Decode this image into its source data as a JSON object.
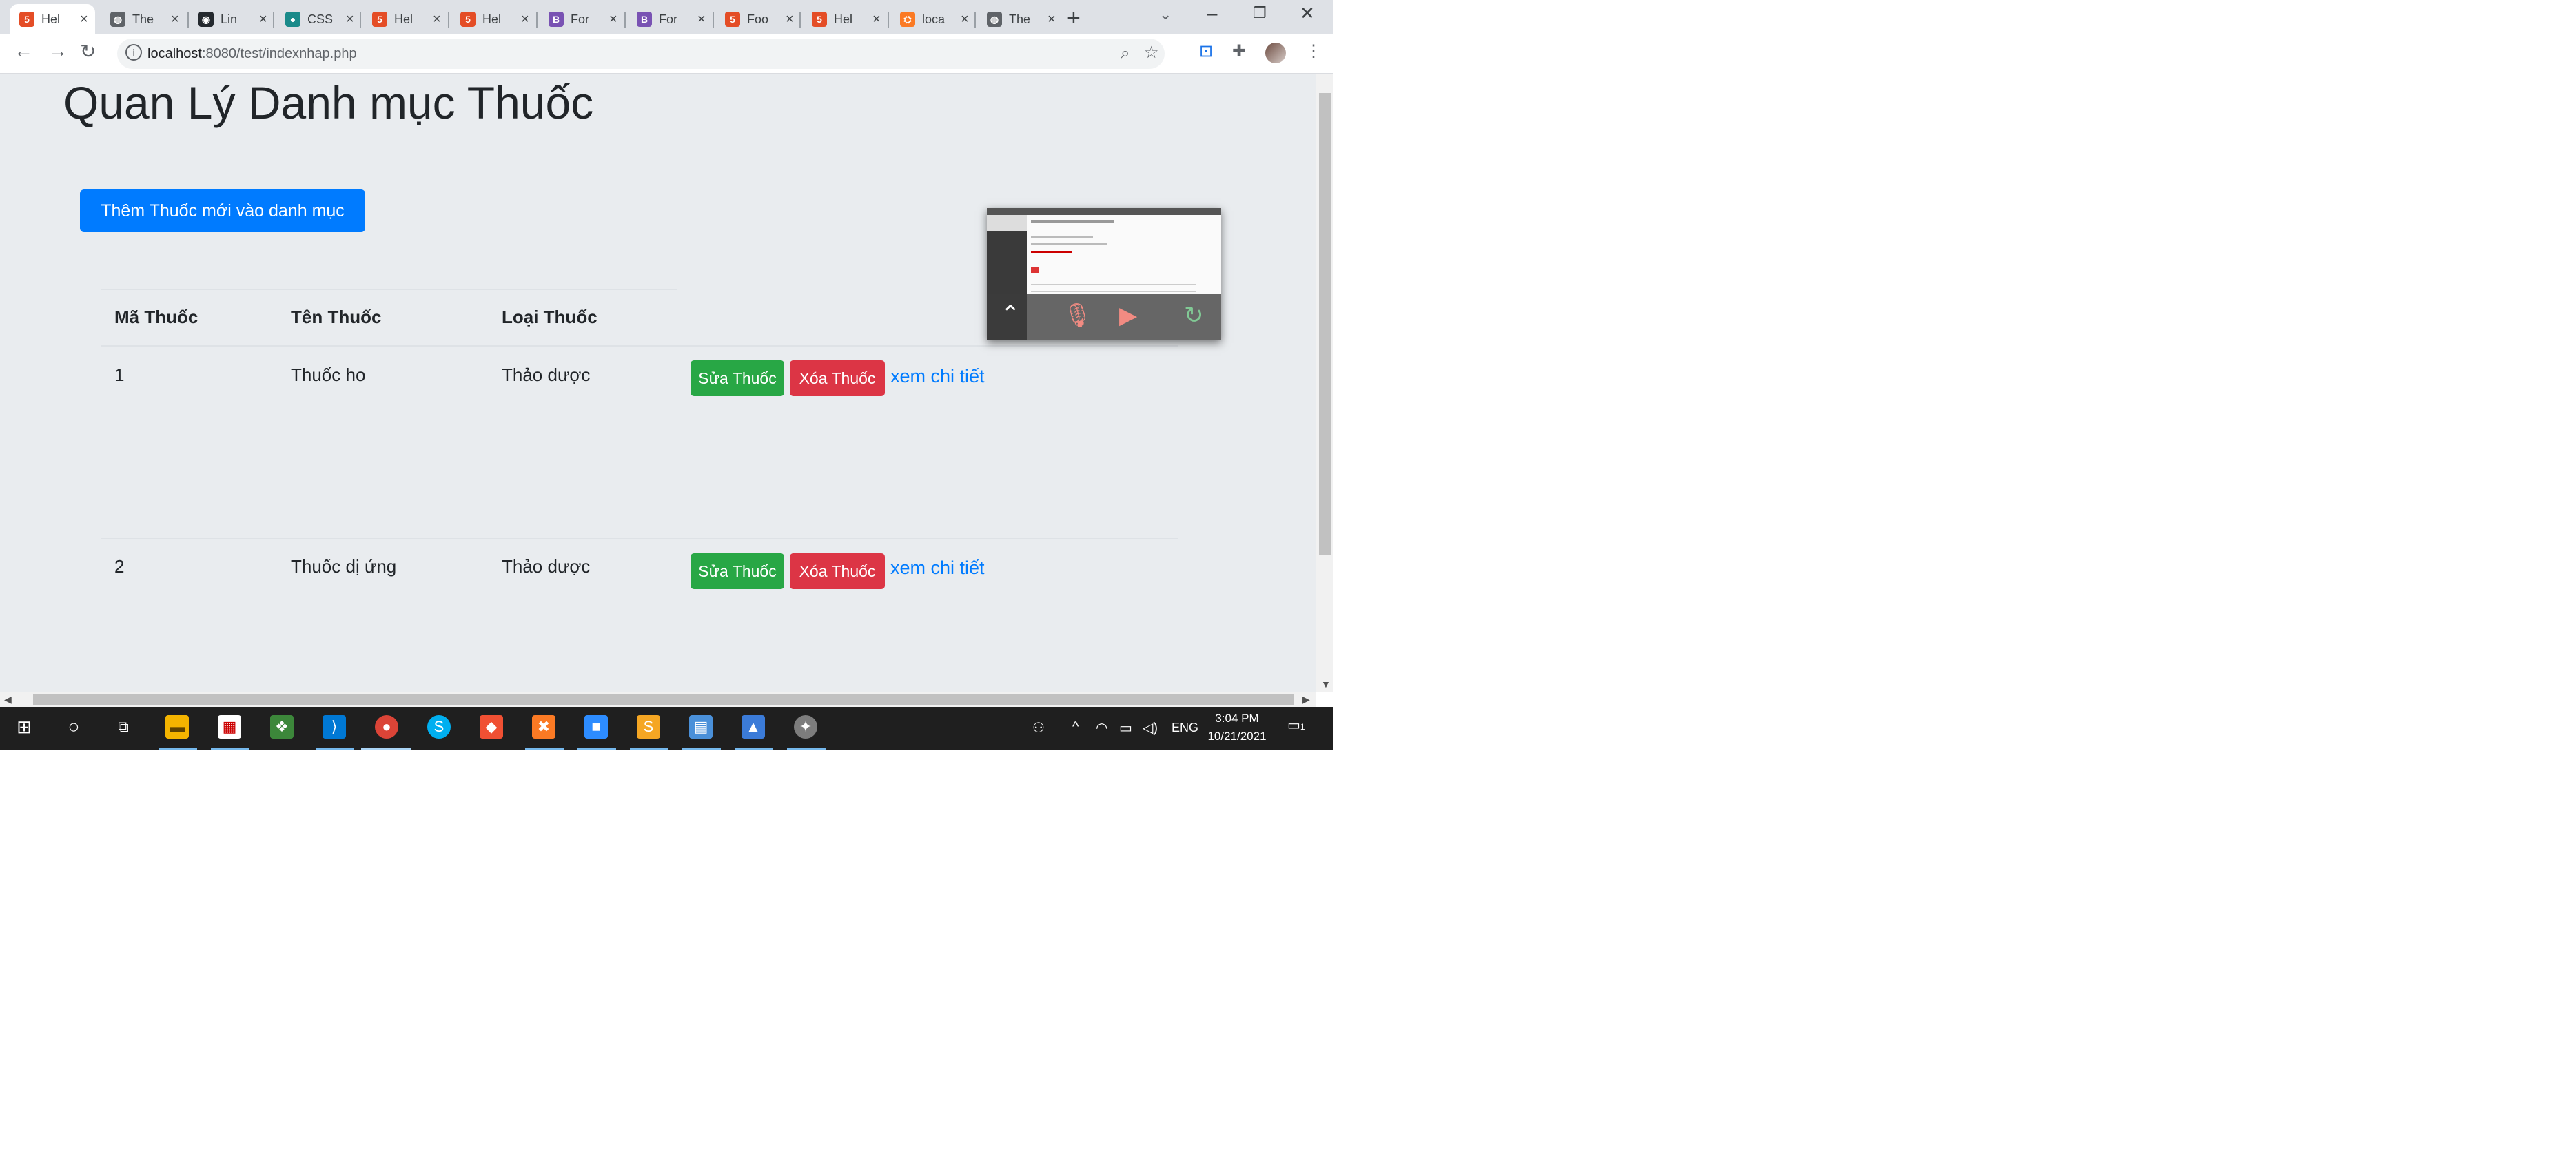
{
  "browser": {
    "tabs": [
      {
        "title": "Hel",
        "favicon": "html5-icon",
        "color": "#e44d26",
        "glyph": "5"
      },
      {
        "title": "The",
        "favicon": "globe-icon",
        "color": "#5f6368",
        "glyph": "◍"
      },
      {
        "title": "Lin",
        "favicon": "github-icon",
        "color": "#24292e",
        "glyph": "◉"
      },
      {
        "title": "CSS",
        "favicon": "dots-icon",
        "color": "#1a8a8a",
        "glyph": "●"
      },
      {
        "title": "Hel",
        "favicon": "html5-icon",
        "color": "#e44d26",
        "glyph": "5"
      },
      {
        "title": "Hel",
        "favicon": "html5-icon",
        "color": "#e44d26",
        "glyph": "5"
      },
      {
        "title": "For",
        "favicon": "bootstrap-icon",
        "color": "#7952b3",
        "glyph": "B"
      },
      {
        "title": "For",
        "favicon": "bootstrap-icon",
        "color": "#7952b3",
        "glyph": "B"
      },
      {
        "title": "Foo",
        "favicon": "html5-icon",
        "color": "#e44d26",
        "glyph": "5"
      },
      {
        "title": "Hel",
        "favicon": "html5-icon",
        "color": "#e44d26",
        "glyph": "5"
      },
      {
        "title": "loca",
        "favicon": "xampp-icon",
        "color": "#fb7a24",
        "glyph": "⛭"
      },
      {
        "title": "The",
        "favicon": "globe-icon",
        "color": "#5f6368",
        "glyph": "◍"
      }
    ],
    "url_host": "localhost",
    "url_path": ":8080/test/indexnhap.php"
  },
  "page": {
    "title": "Quan Lý Danh mục Thuốc",
    "add_button": "Thêm Thuốc mới vào danh mục",
    "table": {
      "headers": [
        "Mã Thuốc",
        "Tên Thuốc",
        "Loại Thuốc"
      ],
      "rows": [
        {
          "id": "1",
          "name": "Thuốc ho",
          "type": "Thảo dược",
          "edit": "Sửa Thuốc",
          "delete": "Xóa Thuốc",
          "detail": "xem chi tiết"
        },
        {
          "id": "2",
          "name": "Thuốc dị ứng",
          "type": "Thảo dược",
          "edit": "Sửa Thuốc",
          "delete": "Xóa Thuốc",
          "detail": "xem chi tiết"
        }
      ]
    }
  },
  "taskbar": {
    "lang": "ENG",
    "time": "3:04 PM",
    "date": "10/21/2021",
    "notifications": "1"
  },
  "colors": {
    "primary": "#007bff",
    "success": "#28a745",
    "danger": "#dc3545",
    "page_bg": "#e9ecef"
  }
}
